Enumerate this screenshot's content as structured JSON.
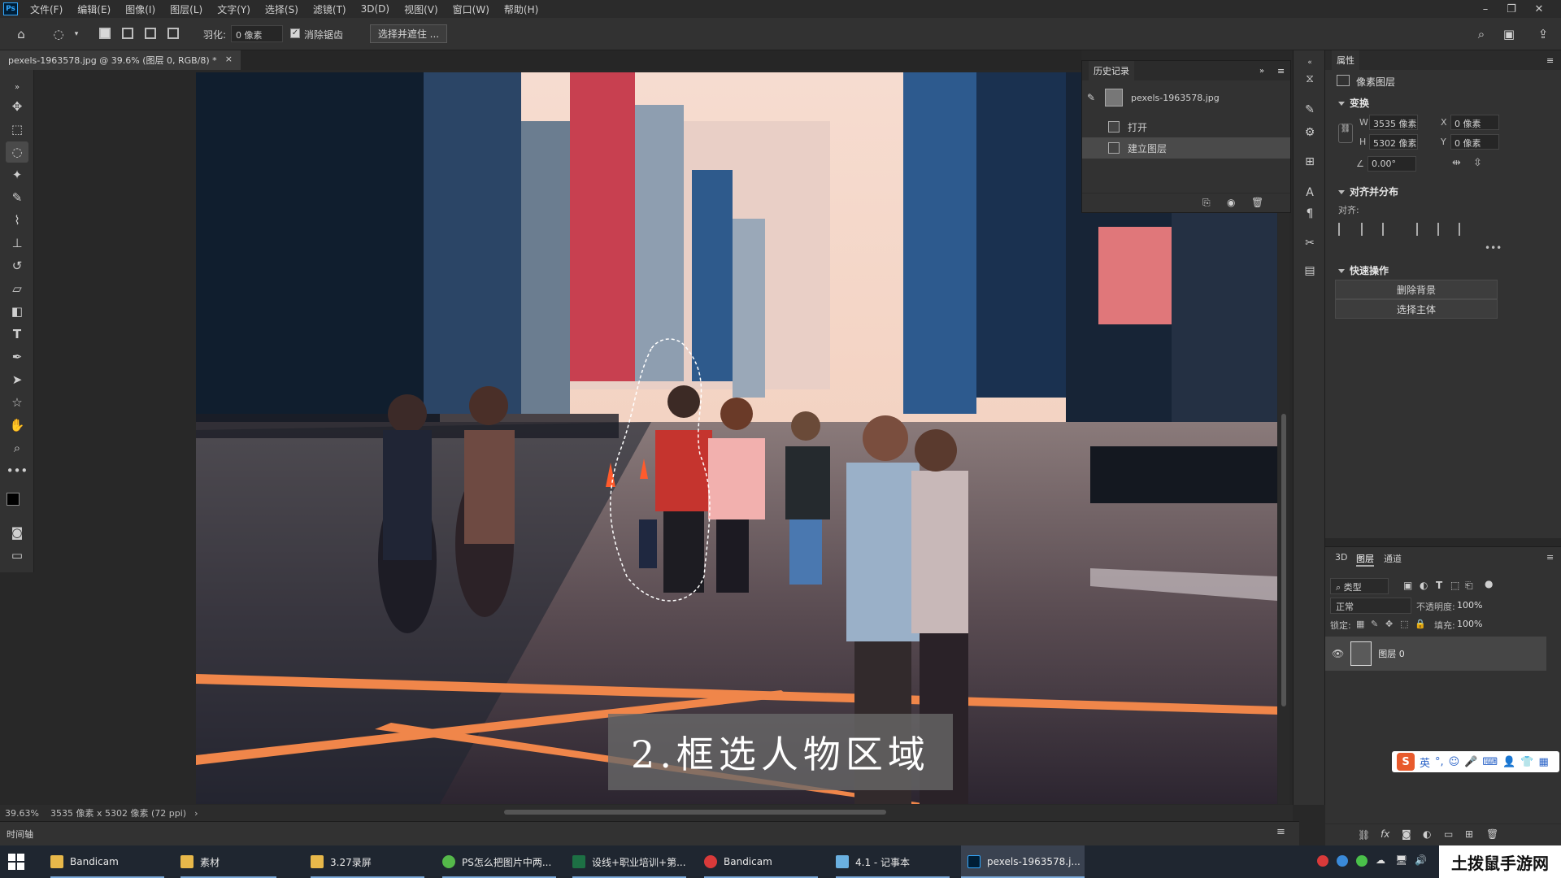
{
  "menubar": {
    "logo": "Ps",
    "items": [
      "文件(F)",
      "编辑(E)",
      "图像(I)",
      "图层(L)",
      "文字(Y)",
      "选择(S)",
      "滤镜(T)",
      "3D(D)",
      "视图(V)",
      "窗口(W)",
      "帮助(H)"
    ]
  },
  "options": {
    "feather_label": "羽化:",
    "feather_value": "0 像素",
    "anti_alias_label": "消除锯齿",
    "anti_alias_checked": true,
    "select_mask_label": "选择并遮住 ..."
  },
  "document": {
    "tab_title": "pexels-1963578.jpg @ 39.6% (图层 0, RGB/8) *",
    "tab_close": "×",
    "caption": "2.框选人物区域"
  },
  "status": {
    "zoom": "39.63%",
    "doc_info": "3535 像素 x 5302 像素 (72 ppi)",
    "arrow": "›"
  },
  "timeline": {
    "label": "时间轴"
  },
  "history": {
    "title": "历史记录",
    "snapshot": "pexels-1963578.jpg",
    "steps": [
      {
        "label": "打开",
        "selected": false
      },
      {
        "label": "建立图层",
        "selected": true
      }
    ]
  },
  "properties": {
    "title": "属性",
    "layer_kind": "像素图层",
    "transform": {
      "title": "变换",
      "w_label": "W",
      "w_value": "3535 像素",
      "h_label": "H",
      "h_value": "5302 像素",
      "x_label": "X",
      "x_value": "0 像素",
      "y_label": "Y",
      "y_value": "0 像素",
      "angle_value": "0.00°"
    },
    "align": {
      "title": "对齐并分布",
      "sub": "对齐:"
    },
    "quick_actions": {
      "title": "快速操作",
      "remove_bg": "删除背景",
      "select_subject": "选择主体"
    }
  },
  "layers": {
    "tabs": [
      "3D",
      "图层",
      "通道"
    ],
    "active_tab": "图层",
    "filter_label": "类型",
    "blend_mode": "正常",
    "opacity_label": "不透明度:",
    "opacity_value": "100%",
    "lock_label": "锁定:",
    "fill_label": "填充:",
    "fill_value": "100%",
    "items": [
      {
        "name": "图层 0",
        "visible": true
      }
    ]
  },
  "ime": {
    "label": "英"
  },
  "taskbar": {
    "apps": [
      {
        "label": "Bandicam",
        "icon": "folder-icon",
        "color": "#e8b84a"
      },
      {
        "label": "素材",
        "icon": "folder-icon",
        "color": "#e8b84a"
      },
      {
        "label": "3.27录屏",
        "icon": "folder-icon",
        "color": "#e8b84a"
      },
      {
        "label": "PS怎么把图片中两...",
        "icon": "browser-icon",
        "color": "#55b84a"
      },
      {
        "label": "设线+职业培训+第...",
        "icon": "excel-icon",
        "color": "#1d7044"
      },
      {
        "label": "Bandicam",
        "icon": "record-icon",
        "color": "#d93a3a"
      },
      {
        "label": "4.1 - 记事本",
        "icon": "notepad-icon",
        "color": "#6ab0e0"
      },
      {
        "label": "pexels-1963578.j...",
        "icon": "photoshop-icon",
        "color": "#31a8ff"
      }
    ]
  },
  "watermark": "土拨鼠手游网"
}
